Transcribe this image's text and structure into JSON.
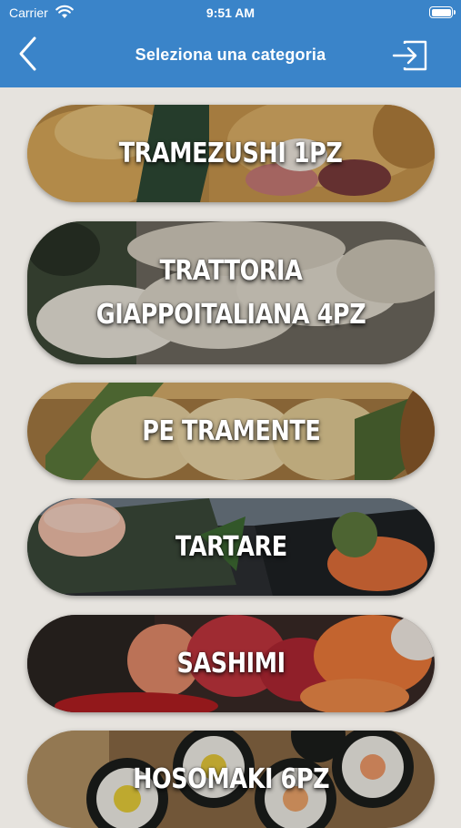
{
  "status_bar": {
    "carrier": "Carrier",
    "time": "9:51 AM"
  },
  "nav": {
    "title": "Seleziona una categoria",
    "back_icon": "chevron-left-icon",
    "login_icon": "sign-in-icon"
  },
  "categories": [
    {
      "label": "TRAMEZUSHI 1PZ"
    },
    {
      "label": "TRATTORIA GIAPPOITALIANA 4PZ"
    },
    {
      "label": "PE TRAMENTE"
    },
    {
      "label": "TARTARE"
    },
    {
      "label": "SASHIMI"
    },
    {
      "label": "HOSOMAKI 6PZ"
    }
  ],
  "colors": {
    "nav_bar": "#3a84c9",
    "background": "#e6e3de"
  }
}
